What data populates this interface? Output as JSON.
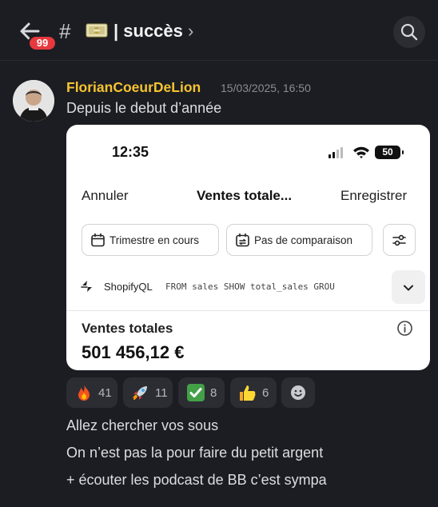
{
  "header": {
    "unread_badge": "99",
    "channel_prefix": "#",
    "channel_name": "| succès",
    "channel_chevron": "›",
    "icons": [
      "back-arrow-icon",
      "money-emoji-icon",
      "search-icon"
    ]
  },
  "message": {
    "author": "FlorianCoeurDeLion",
    "author_color": "#f4c430",
    "timestamp": "15/03/2025, 16:50",
    "first_line": "Depuis le debut d’année",
    "screenshot": {
      "status_time": "12:35",
      "battery": "50",
      "nav": {
        "cancel": "Annuler",
        "title": "Ventes totale...",
        "save": "Enregistrer"
      },
      "filters": {
        "period": "Trimestre en cours",
        "comparison": "Pas de comparaison"
      },
      "query": {
        "label": "ShopifyQL",
        "code": "FROM sales SHOW total_sales GROU"
      },
      "metric": {
        "title": "Ventes totales",
        "value": "501 456,12 €"
      }
    },
    "reactions": [
      {
        "emoji": "fire-emoji-icon",
        "count": "41"
      },
      {
        "emoji": "rocket-emoji-icon",
        "count": "11"
      },
      {
        "emoji": "check-mark-button-emoji-icon",
        "count": "8"
      },
      {
        "emoji": "thumbs-up-emoji-icon",
        "count": "6"
      },
      {
        "emoji": "add-reaction-icon",
        "count": ""
      }
    ],
    "lines": [
      "Allez chercher vos sous",
      "On n’est pas la pour faire du petit argent",
      "+ écouter les podcast de BB c’est sympa"
    ]
  }
}
